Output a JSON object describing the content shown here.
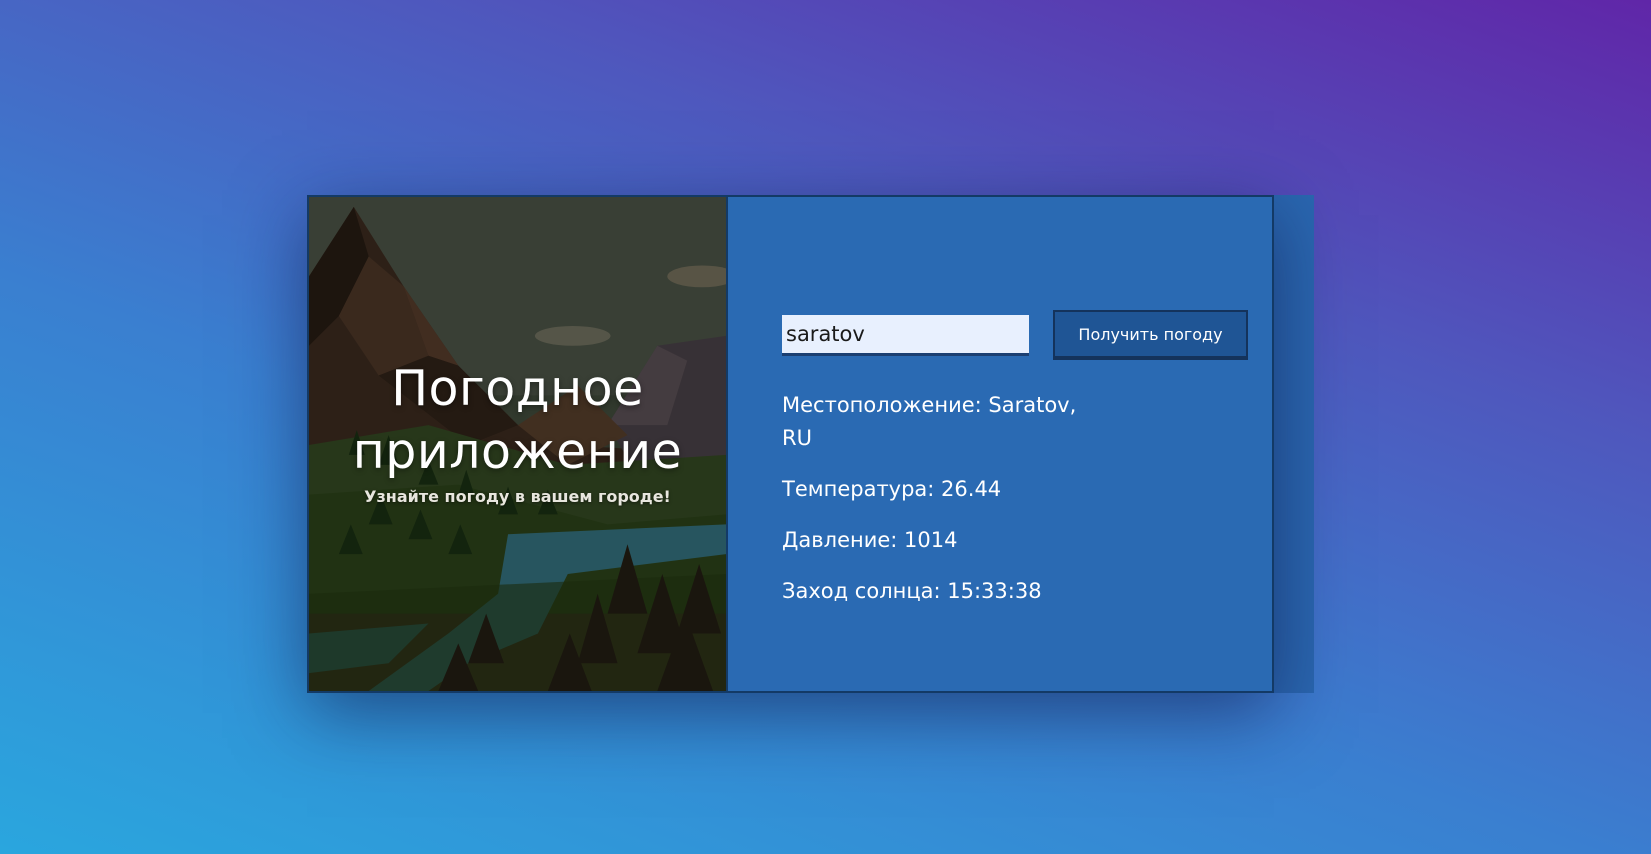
{
  "app": {
    "title": "Погодное приложение",
    "subtitle": "Узнайте погоду в вашем городе!"
  },
  "form": {
    "city_value": "saratov",
    "button_label": "Получить погоду"
  },
  "weather": {
    "location": "Местоположение: Saratov, RU",
    "temperature": "Температура: 26.44",
    "pressure": "Давление: 1014",
    "sunset": "Заход солнца: 15:33:38"
  },
  "colors": {
    "panel": "#2a6ab3",
    "button": "#1f5595",
    "input_bg": "#e8f0fe"
  }
}
